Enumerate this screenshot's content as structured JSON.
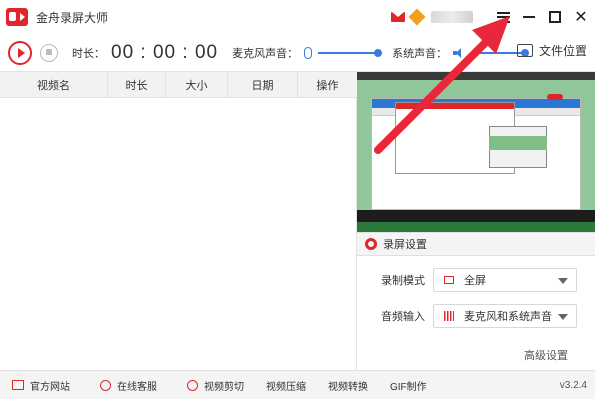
{
  "app": {
    "title": "金舟录屏大师"
  },
  "toolbar": {
    "duration_label": "时长：",
    "duration_value": "00 : 00 : 00",
    "mic_label": "麦克风声音：",
    "system_label": "系统声音：",
    "file_location_label": "文件位置"
  },
  "table": {
    "columns": [
      "视频名",
      "时长",
      "大小",
      "日期",
      "操作"
    ]
  },
  "settings": {
    "title": "录屏设置",
    "record_mode_label": "录制模式",
    "record_mode_value": "全屏",
    "audio_input_label": "音频输入",
    "audio_input_value": "麦克风和系统声音",
    "advanced_label": "高级设置"
  },
  "statusbar": {
    "items": [
      "官方网站",
      "在线客服",
      "视频剪切",
      "视频压缩",
      "视频转换",
      "GIF制作"
    ],
    "version": "v3.2.4"
  },
  "colors": {
    "accent_red": "#e0252b",
    "accent_blue": "#3a7be0",
    "annotation_arrow": "#e8283a"
  },
  "icons": [
    "app-logo-icon",
    "mail-icon",
    "vip-icon",
    "menu-icon",
    "minimize-icon",
    "maximize-icon",
    "close-icon",
    "record-icon",
    "stop-icon",
    "microphone-icon",
    "speaker-icon",
    "folder-icon",
    "gear-icon",
    "monitor-icon",
    "audio-wave-icon",
    "website-icon",
    "customer-service-icon",
    "cut-icon"
  ]
}
